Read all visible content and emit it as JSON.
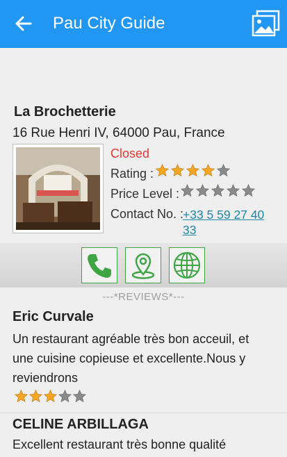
{
  "app_bar": {
    "title": "Pau City Guide",
    "back_icon": "arrow-left-icon",
    "gallery_icon": "image-gallery-icon",
    "color": "#2196f3"
  },
  "place": {
    "name": "La Brochetterie",
    "address": "16 Rue Henri IV, 64000 Pau, France",
    "status": "Closed",
    "status_color": "#e53935",
    "rating_label": "Rating :",
    "rating": 4,
    "rating_max": 5,
    "price_label": "Price Level :",
    "price_level": 0,
    "price_max": 5,
    "contact_label": "Contact No. :",
    "phone": "+33 5 59 27 40 33"
  },
  "actions": [
    {
      "name": "call",
      "icon": "phone-icon"
    },
    {
      "name": "directions",
      "icon": "map-pin-icon"
    },
    {
      "name": "website",
      "icon": "globe-icon"
    }
  ],
  "reviews_header": "---*REVIEWS*---",
  "reviews": [
    {
      "author": "Eric Curvale",
      "text": "Un restaurant agréable très bon acceuil, et une cuisine copieuse et excellente.Nous y reviendrons",
      "rating": 3,
      "rating_max": 5
    },
    {
      "author": "CELINE ARBILLAGA",
      "text": "Excellent restaurant très bonne qualité"
    }
  ],
  "colors": {
    "accent_green": "#3ea543",
    "star_gold": "#f5a623",
    "star_gray": "#8a8a8a",
    "link": "#1e88a8"
  }
}
